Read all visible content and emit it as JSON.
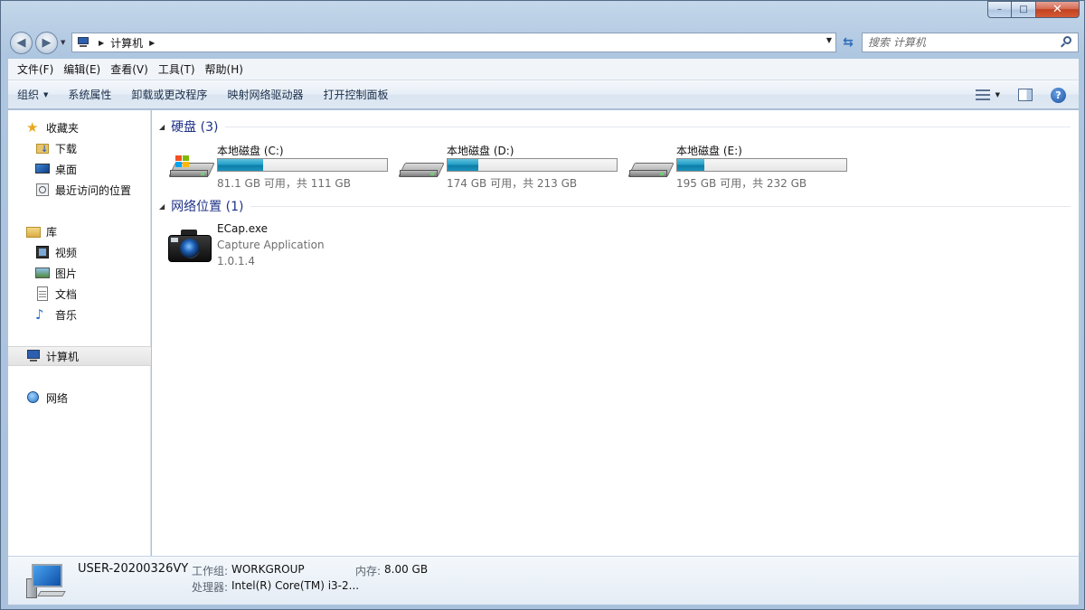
{
  "window": {
    "controls": {
      "min": "–",
      "max": "□",
      "close": "✕"
    }
  },
  "address": {
    "crumbs": [
      "计算机"
    ]
  },
  "search": {
    "placeholder": "搜索 计算机"
  },
  "menubar": [
    "文件(F)",
    "编辑(E)",
    "查看(V)",
    "工具(T)",
    "帮助(H)"
  ],
  "toolbar": {
    "organize": "组织",
    "buttons": [
      "系统属性",
      "卸载或更改程序",
      "映射网络驱动器",
      "打开控制面板"
    ]
  },
  "navpane": {
    "favorites": {
      "label": "收藏夹",
      "items": [
        "下载",
        "桌面",
        "最近访问的位置"
      ]
    },
    "libraries": {
      "label": "库",
      "items": [
        "视频",
        "图片",
        "文档",
        "音乐"
      ]
    },
    "computer": "计算机",
    "network": "网络"
  },
  "groups": {
    "hdd": {
      "title": "硬盘 (3)"
    },
    "network": {
      "title": "网络位置 (1)"
    }
  },
  "drives": [
    {
      "name": "本地磁盘 (C:)",
      "free": "81.1 GB 可用，共 111 GB",
      "used_fraction": 0.27,
      "system": true
    },
    {
      "name": "本地磁盘 (D:)",
      "free": "174 GB 可用，共 213 GB",
      "used_fraction": 0.18,
      "system": false
    },
    {
      "name": "本地磁盘 (E:)",
      "free": "195 GB 可用，共 232 GB",
      "used_fraction": 0.16,
      "system": false
    }
  ],
  "app": {
    "name": "ECap.exe",
    "description": "Capture Application",
    "version": "1.0.1.4"
  },
  "details": {
    "computer_name": "USER-20200326VY",
    "workgroup_label": "工作组:",
    "workgroup": "WORKGROUP",
    "memory_label": "内存:",
    "memory": "8.00 GB",
    "cpu_label": "处理器:",
    "cpu": "Intel(R) Core(TM) i3-2..."
  },
  "colors": {
    "accent": "#1e3287",
    "drive_bar": "#26a0c8",
    "chrome": "#aec6e0"
  }
}
